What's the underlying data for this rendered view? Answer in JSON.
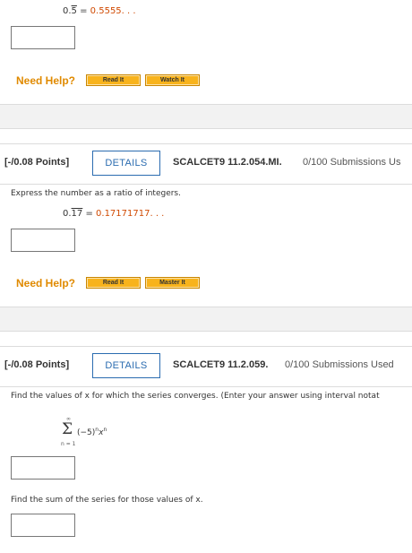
{
  "q1_tail": {
    "expr_lhs_int": "0.",
    "expr_lhs_rep": "5",
    "expr_eq": " = ",
    "expr_decimal": "0.5555. . .",
    "need_help": "Need Help?",
    "btn_read": "Read It",
    "btn_watch": "Watch It"
  },
  "q2": {
    "points": "[-/0.08 Points]",
    "details": "DETAILS",
    "id": "SCALCET9 11.2.054.MI.",
    "submissions": "0/100 Submissions Us",
    "prompt": "Express the number as a ratio of integers.",
    "expr_lhs_int": "0.",
    "expr_lhs_rep": "17",
    "expr_eq": " = ",
    "expr_decimal": "0.17171717. . .",
    "need_help": "Need Help?",
    "btn_read": "Read It",
    "btn_master": "Master It"
  },
  "q3": {
    "points": "[-/0.08 Points]",
    "details": "DETAILS",
    "id": "SCALCET9 11.2.059.",
    "submissions": "0/100 Submissions Used",
    "prompt": "Find the values of x for which the series converges. (Enter your answer using interval notat",
    "sum_upper": "∞",
    "sum_symbol": "Σ",
    "sum_lower": "n = 1",
    "term_base": "(−5)",
    "term_exp1": "n",
    "term_var": "x",
    "term_exp2": "n",
    "prompt2": "Find the sum of the series for those values of x."
  }
}
